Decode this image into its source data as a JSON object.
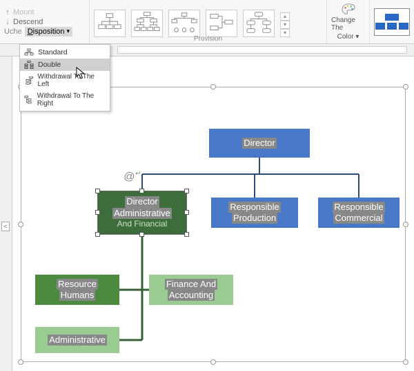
{
  "ribbon": {
    "mount": "Mount",
    "descend": "Descend",
    "uche": "Uche",
    "disposition": "Disposition",
    "provision_label": "Provision",
    "change_colors_1": "Change The",
    "change_colors_2": "Color"
  },
  "dropdown": {
    "standard": "Standard",
    "double": "Double",
    "left": "Withdrawal To The Left",
    "right": "Withdrawal To The Right"
  },
  "chart": {
    "director": "Director",
    "daf_l1": "Director",
    "daf_l2": "Administrative",
    "daf_l3": "And Financial",
    "prod_l1": "Responsible",
    "prod_l2": "Production",
    "comm_l1": "Responsible",
    "comm_l2": "Commercial",
    "hr_l1": "Resource",
    "hr_l2": "Humans",
    "fin_l1": "Finance And",
    "fin_l2": "Accounting",
    "adm": "Administrative"
  },
  "chart_data": {
    "type": "org-hierarchy",
    "root": {
      "label": "Director",
      "children": [
        {
          "label": "Director Administrative And Financial",
          "selected": true,
          "children": [
            {
              "label": "Resource Humans"
            },
            {
              "label": "Finance And Accounting"
            },
            {
              "label": "Administrative"
            }
          ]
        },
        {
          "label": "Responsible Production"
        },
        {
          "label": "Responsible Commercial"
        }
      ]
    }
  }
}
